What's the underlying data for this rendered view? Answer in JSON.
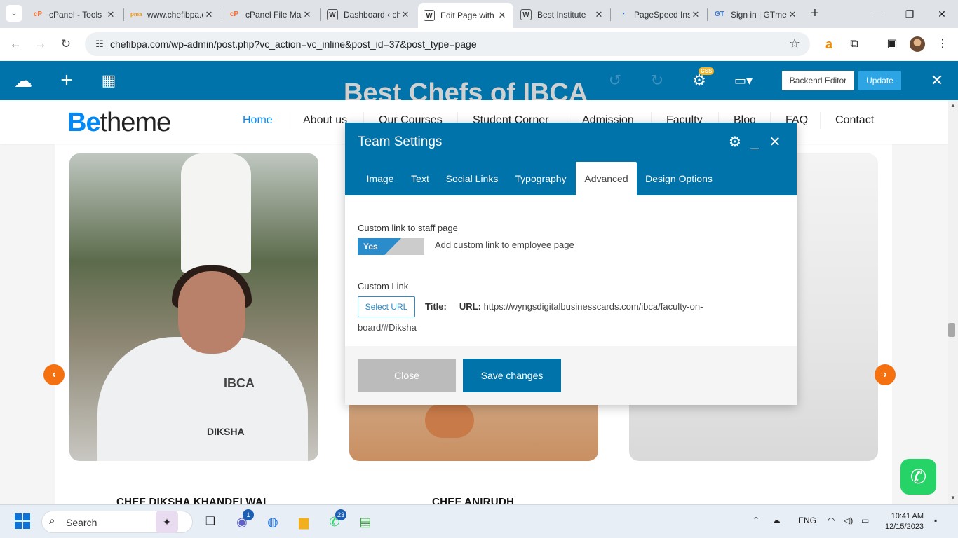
{
  "browser": {
    "tabs": [
      {
        "title": "cPanel - Tools",
        "favicon": "cpanel-icon",
        "active": false
      },
      {
        "title": "www.chefibpa.com",
        "favicon": "phpmyadmin-icon",
        "active": false
      },
      {
        "title": "cPanel File Manager",
        "favicon": "cpanel-icon",
        "active": false
      },
      {
        "title": "Dashboard ‹ chefibpa",
        "favicon": "wordpress-icon",
        "active": false
      },
      {
        "title": "Edit Page with WPBakery",
        "favicon": "wordpress-icon",
        "active": true
      },
      {
        "title": "Best Institute",
        "favicon": "wordpress-icon",
        "active": false
      },
      {
        "title": "PageSpeed Insights",
        "favicon": "pagespeed-icon",
        "active": false
      },
      {
        "title": "Sign in | GTmetrix",
        "favicon": "gtmetrix-icon",
        "active": false
      }
    ],
    "url": "chefibpa.com/wp-admin/post.php?vc_action=vc_inline&post_id=37&post_type=page"
  },
  "vc_bar": {
    "css_badge": "CSS",
    "backend_editor": "Backend Editor",
    "update": "Update"
  },
  "site": {
    "logo_be": "Be",
    "logo_theme": "theme",
    "behind_heading": "Best Chefs of IBCA",
    "nav": [
      "Home",
      "About us",
      "Our Courses",
      "Student Corner",
      "Admission",
      "Faculty",
      "Blog",
      "FAQ",
      "Contact"
    ],
    "coat_ibca": "IBCA",
    "coat_name": "DIKSHA",
    "chef_names": [
      "CHEF DIKSHA KHANDELWAL",
      "CHEF ANIRUDH"
    ]
  },
  "modal": {
    "title": "Team Settings",
    "tabs": [
      "Image",
      "Text",
      "Social Links",
      "Typography",
      "Advanced",
      "Design Options"
    ],
    "active_tab": "Advanced",
    "custom_link_label": "Custom link to staff page",
    "toggle_value": "Yes",
    "toggle_desc": "Add custom link to employee page",
    "custom_link_field": "Custom Link",
    "select_url": "Select URL",
    "title_label": "Title:",
    "url_label": "URL:",
    "url_value_1": "https://wyngsdigitalbusinesscards.com/ibca/faculty-on-",
    "url_value_2": "board/#Diksha",
    "close": "Close",
    "save": "Save changes"
  },
  "taskbar": {
    "search": "Search",
    "teams_badge": "1",
    "whatsapp_badge": "23",
    "lang": "ENG",
    "time": "10:41 AM",
    "date": "12/15/2023"
  },
  "colors": {
    "wp_blue": "#0073aa",
    "betheme_blue": "#0089f7",
    "accent_orange": "#f5700f"
  }
}
